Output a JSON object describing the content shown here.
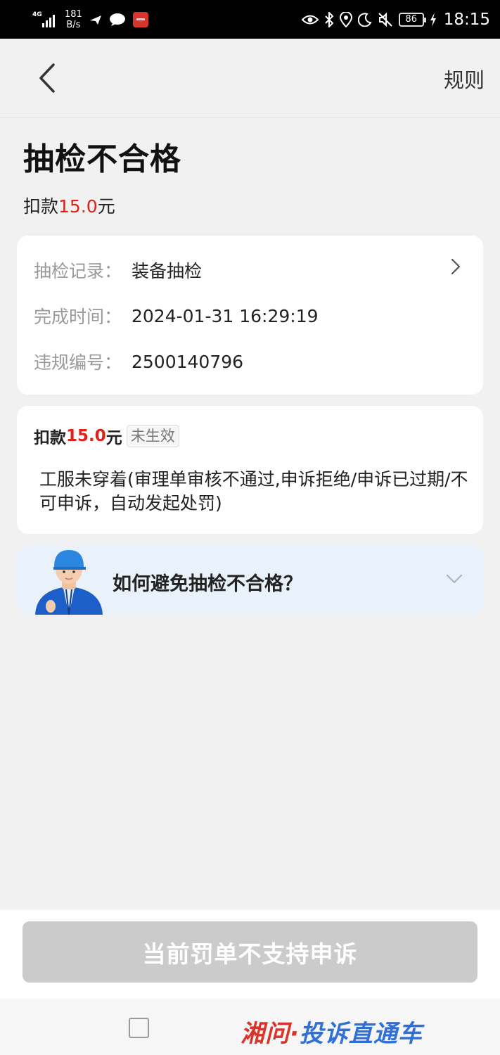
{
  "status_bar": {
    "network": "4G",
    "net_speed_value": "181",
    "net_speed_unit": "B/s",
    "battery": "86",
    "time": "18:15"
  },
  "nav": {
    "rules_label": "规则"
  },
  "header": {
    "title": "抽检不合格",
    "deduct_prefix": "扣款",
    "deduct_amount": "15.0",
    "deduct_suffix": "元"
  },
  "record": {
    "rows": [
      {
        "key": "抽检记录：",
        "value": "装备抽检"
      },
      {
        "key": "完成时间：",
        "value": "2024-01-31 16:29:19"
      },
      {
        "key": "违规编号：",
        "value": "2500140796"
      }
    ]
  },
  "penalty": {
    "prefix": "扣款",
    "amount": "15.0",
    "suffix": "元",
    "status_badge": "未生效",
    "description": "工服未穿着(审理单审核不通过,申诉拒绝/申诉已过期/不可申诉，自动发起处罚)"
  },
  "faq": {
    "question": "如何避免抽检不合格？"
  },
  "bottom": {
    "appeal_button": "当前罚单不支持申诉"
  },
  "watermark": {
    "part_a": "湘问·",
    "part_b": "投诉直通车"
  },
  "colors": {
    "accent_red": "#e0211a",
    "disabled_button": "#cbcbcb",
    "faq_bg": "#e9f1fb"
  },
  "icons": [
    "back-arrow-icon",
    "chevron-right-icon",
    "chevron-down-icon",
    "eye-icon",
    "bluetooth-icon",
    "location-icon",
    "moon-icon",
    "mute-icon",
    "battery-icon",
    "wifi-signal-icon",
    "message-icon",
    "app-icon"
  ]
}
